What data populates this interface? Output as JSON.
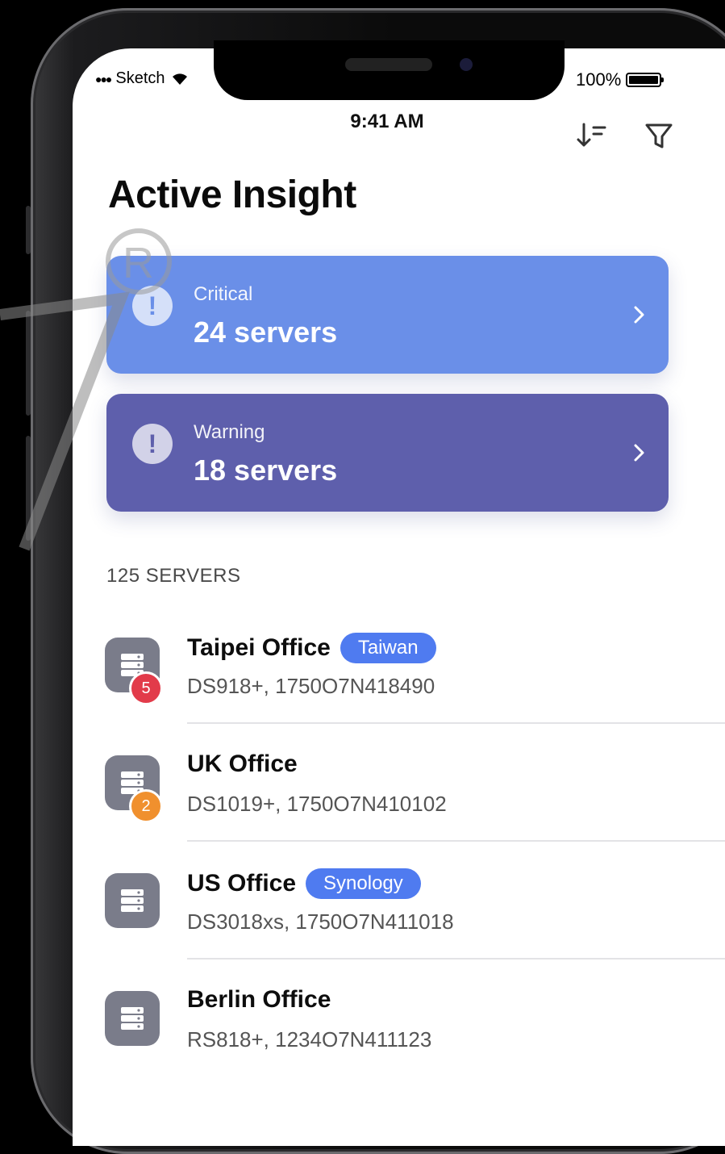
{
  "status_bar": {
    "carrier": "Sketch",
    "time": "9:41 AM",
    "battery": "100%"
  },
  "toolbar": {
    "sort_icon": "sort-descending-icon",
    "filter_icon": "filter-icon"
  },
  "page": {
    "title": "Active Insight"
  },
  "summary_cards": [
    {
      "label": "Critical",
      "count": "24 servers",
      "color": "#6a8fe8",
      "icon": "alert-circle-icon"
    },
    {
      "label": "Warning",
      "count": "18 servers",
      "color": "#5e5fac",
      "icon": "alert-circle-icon"
    }
  ],
  "server_list": {
    "header": "125 SERVERS",
    "items": [
      {
        "name": "Taipei Office",
        "tag": "Taiwan",
        "detail": "DS918+, 1750O7N418490",
        "badge": "5",
        "badge_color": "#e23b4a"
      },
      {
        "name": "UK Office",
        "tag": "",
        "detail": "DS1019+, 1750O7N410102",
        "badge": "2",
        "badge_color": "#f0902e"
      },
      {
        "name": "US Office",
        "tag": "Synology",
        "detail": "DS3018xs, 1750O7N411018",
        "badge": "",
        "badge_color": ""
      },
      {
        "name": "Berlin Office",
        "tag": "",
        "detail": "RS818+, 1234O7N411123",
        "badge": "",
        "badge_color": ""
      }
    ]
  },
  "colors": {
    "accent": "#4f7bf0",
    "critical": "#6a8fe8",
    "warning": "#5e5fac"
  }
}
